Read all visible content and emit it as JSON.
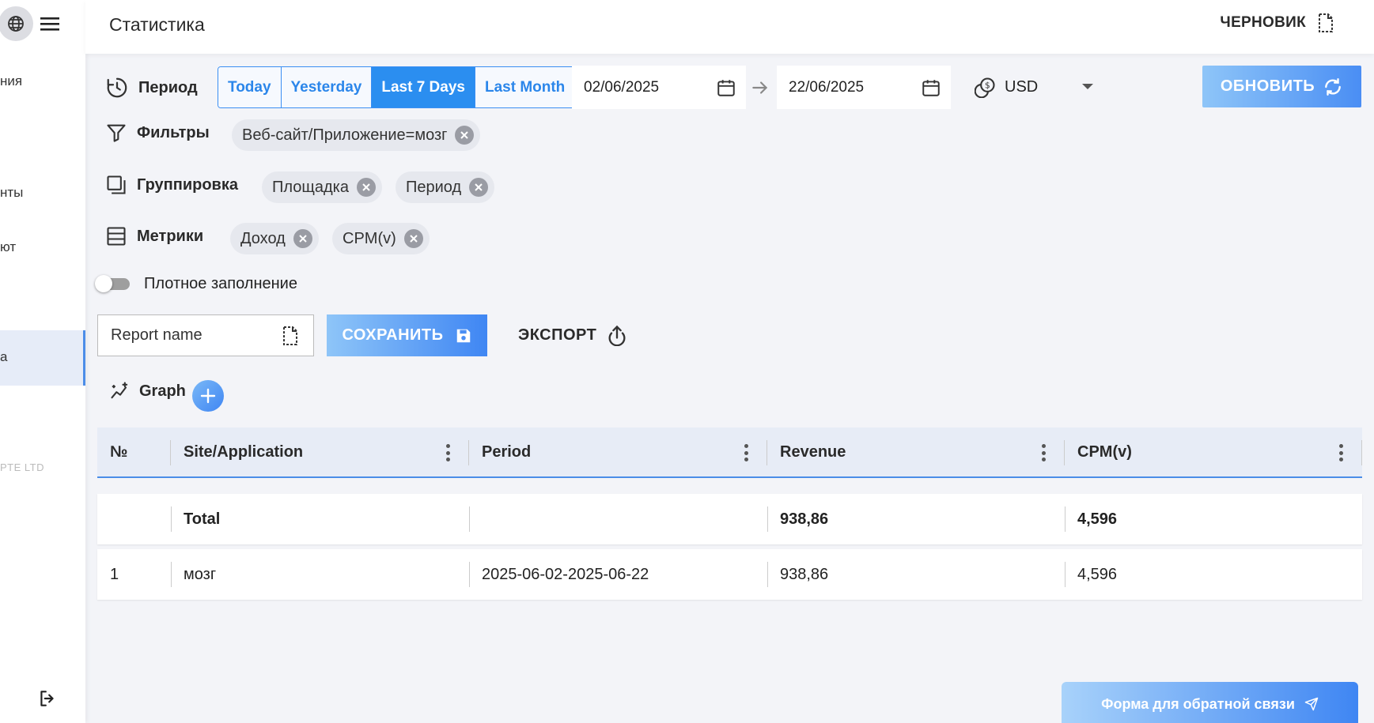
{
  "sidebar": {
    "items": [
      {
        "label": "ния"
      },
      {
        "label": "нты"
      },
      {
        "label": "ют"
      },
      {
        "label": "а"
      }
    ],
    "footer": "PTE LTD"
  },
  "header": {
    "title": "Статистика",
    "draft_label": "ЧЕРНОВИК"
  },
  "period": {
    "label": "Период",
    "options": [
      "Today",
      "Yesterday",
      "Last 7 Days",
      "Last Month"
    ],
    "selected": "Last 7 Days",
    "date_from": "02/06/2025",
    "date_to": "22/06/2025",
    "currency": "USD",
    "refresh_label": "ОБНОВИТЬ"
  },
  "filters": {
    "label": "Фильтры",
    "chips": [
      "Веб-сайт/Приложение=мозг"
    ]
  },
  "grouping": {
    "label": "Группировка",
    "chips": [
      "Площадка",
      "Период"
    ]
  },
  "metrics": {
    "label": "Метрики",
    "chips": [
      "Доход",
      "CPM(v)"
    ]
  },
  "dense_fill": {
    "label": "Плотное заполнение",
    "enabled": false
  },
  "report": {
    "name_placeholder": "Report name",
    "save_label": "СОХРАНИТЬ",
    "export_label": "ЭКСПОРТ"
  },
  "graph": {
    "label": "Graph"
  },
  "table": {
    "headers": [
      "№",
      "Site/Application",
      "Period",
      "Revenue",
      "CPM(v)"
    ],
    "total": {
      "label": "Total",
      "period": "",
      "revenue": "938,86",
      "cpm": "4,596"
    },
    "rows": [
      {
        "num": "1",
        "site": "мозг",
        "period": "2025-06-02-2025-06-22",
        "revenue": "938,86",
        "cpm": "4,596"
      }
    ]
  },
  "feedback_label": "Форма для обратной связи",
  "colors": {
    "accent": "#2b8ef0",
    "sidebar_active_bg": "#e6ecf8",
    "chip_bg": "#e6e8ee"
  }
}
